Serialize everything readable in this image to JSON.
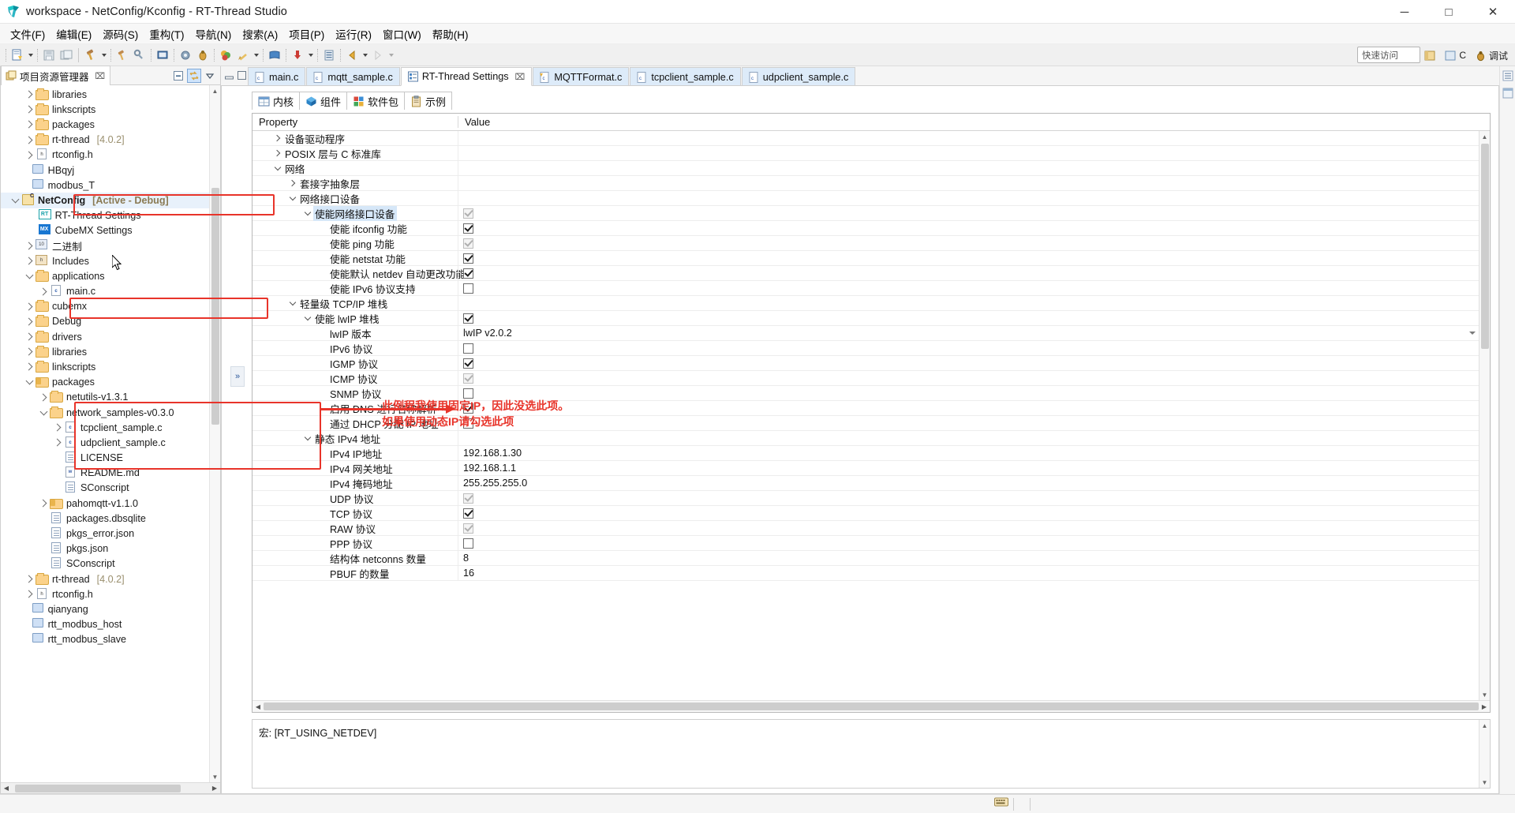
{
  "window": {
    "title": "workspace - NetConfig/Kconfig - RT-Thread Studio",
    "app_icon": "rtthread-logo-icon",
    "buttons": {
      "minimize": "─",
      "maximize": "□",
      "close": "✕"
    }
  },
  "menubar": {
    "items": [
      {
        "label": "文件(F)"
      },
      {
        "label": "编辑(E)"
      },
      {
        "label": "源码(S)"
      },
      {
        "label": "重构(T)"
      },
      {
        "label": "导航(N)"
      },
      {
        "label": "搜索(A)"
      },
      {
        "label": "项目(P)"
      },
      {
        "label": "运行(R)"
      },
      {
        "label": "窗口(W)"
      },
      {
        "label": "帮助(H)"
      }
    ]
  },
  "toolbar": {
    "quick_access_placeholder": "快速访问",
    "perspective_c": "C",
    "perspective_debug": "调试",
    "icons": [
      "new-file-icon",
      "save-icon",
      "save-all-icon",
      "build-hammer-icon",
      "clean-hammer-icon",
      "wrench-icon",
      "terminal-icon",
      "settings-gear-icon",
      "debug-bug-icon",
      "package-icon",
      "pencil-icon",
      "book-icon",
      "download-icon",
      "list-icon",
      "back-arrow-icon",
      "forward-arrow-icon"
    ]
  },
  "project_explorer": {
    "tab_title": "项目资源管理器",
    "tab_close": "⌧",
    "tools": [
      "collapse-all-icon",
      "link-with-editor-icon",
      "view-menu-icon"
    ],
    "items": [
      {
        "indent": 1,
        "twisty": "right",
        "icon": "folder",
        "label": "libraries"
      },
      {
        "indent": 1,
        "twisty": "right",
        "icon": "folder",
        "label": "linkscripts"
      },
      {
        "indent": 1,
        "twisty": "right",
        "icon": "folder",
        "label": "packages"
      },
      {
        "indent": 1,
        "twisty": "right",
        "icon": "folder",
        "label": "rt-thread",
        "suffix": "[4.0.2]"
      },
      {
        "indent": 1,
        "twisty": "right",
        "icon": "header",
        "label": "rtconfig.h"
      },
      {
        "indent": 0.7,
        "twisty": "none",
        "icon": "box",
        "label": "HBqyj"
      },
      {
        "indent": 0.7,
        "twisty": "none",
        "icon": "box",
        "label": "modbus_T"
      },
      {
        "indent": 0,
        "twisty": "down",
        "icon": "project",
        "label": "NetConfig",
        "bold": true,
        "suffix": "[Active - Debug]",
        "selected": true
      },
      {
        "indent": 1.2,
        "twisty": "none",
        "icon": "rt",
        "label": "RT-Thread Settings"
      },
      {
        "indent": 1.2,
        "twisty": "none",
        "icon": "mx",
        "label": "CubeMX Settings"
      },
      {
        "indent": 1,
        "twisty": "right",
        "icon": "bin",
        "label": "二进制"
      },
      {
        "indent": 1,
        "twisty": "right",
        "icon": "includes",
        "label": "Includes"
      },
      {
        "indent": 1,
        "twisty": "down",
        "icon": "folder",
        "label": "applications"
      },
      {
        "indent": 2,
        "twisty": "right",
        "icon": "cfile",
        "label": "main.c"
      },
      {
        "indent": 1,
        "twisty": "right",
        "icon": "folder",
        "label": "cubemx"
      },
      {
        "indent": 1,
        "twisty": "right",
        "icon": "folder",
        "label": "Debug"
      },
      {
        "indent": 1,
        "twisty": "right",
        "icon": "folder",
        "label": "drivers"
      },
      {
        "indent": 1,
        "twisty": "right",
        "icon": "folder",
        "label": "libraries"
      },
      {
        "indent": 1,
        "twisty": "right",
        "icon": "folder",
        "label": "linkscripts"
      },
      {
        "indent": 1,
        "twisty": "down",
        "icon": "pkgfolder",
        "label": "packages"
      },
      {
        "indent": 2,
        "twisty": "right",
        "icon": "folder",
        "label": "netutils-v1.3.1"
      },
      {
        "indent": 2,
        "twisty": "down",
        "icon": "folder",
        "label": "network_samples-v0.3.0"
      },
      {
        "indent": 3,
        "twisty": "right",
        "icon": "cfile",
        "label": "tcpclient_sample.c"
      },
      {
        "indent": 3,
        "twisty": "right",
        "icon": "cfile",
        "label": "udpclient_sample.c"
      },
      {
        "indent": 3,
        "twisty": "none",
        "icon": "file",
        "label": "LICENSE"
      },
      {
        "indent": 3,
        "twisty": "none",
        "icon": "md",
        "label": "README.md"
      },
      {
        "indent": 3,
        "twisty": "none",
        "icon": "file",
        "label": "SConscript"
      },
      {
        "indent": 2,
        "twisty": "right",
        "icon": "pkgfolder",
        "label": "pahomqtt-v1.1.0"
      },
      {
        "indent": 2,
        "twisty": "none",
        "icon": "file",
        "label": "packages.dbsqlite"
      },
      {
        "indent": 2,
        "twisty": "none",
        "icon": "file",
        "label": "pkgs_error.json"
      },
      {
        "indent": 2,
        "twisty": "none",
        "icon": "file",
        "label": "pkgs.json"
      },
      {
        "indent": 2,
        "twisty": "none",
        "icon": "file",
        "label": "SConscript"
      },
      {
        "indent": 1,
        "twisty": "right",
        "icon": "folder",
        "label": "rt-thread",
        "suffix": "[4.0.2]"
      },
      {
        "indent": 1,
        "twisty": "right",
        "icon": "header",
        "label": "rtconfig.h"
      },
      {
        "indent": 0.7,
        "twisty": "none",
        "icon": "box",
        "label": "qianyang"
      },
      {
        "indent": 0.7,
        "twisty": "none",
        "icon": "box",
        "label": "rtt_modbus_host"
      },
      {
        "indent": 0.7,
        "twisty": "none",
        "icon": "box",
        "label": "rtt_modbus_slave"
      }
    ]
  },
  "editor_tabs": [
    {
      "label": "main.c",
      "icon": "c-file-icon",
      "active": false
    },
    {
      "label": "mqtt_sample.c",
      "icon": "c-file-icon",
      "active": false
    },
    {
      "label": "RT-Thread Settings",
      "icon": "settings-icon",
      "active": true,
      "close": "⌧"
    },
    {
      "label": "MQTTFormat.c",
      "icon": "c-warning-icon",
      "active": false
    },
    {
      "label": "tcpclient_sample.c",
      "icon": "c-file-icon",
      "active": false
    },
    {
      "label": "udpclient_sample.c",
      "icon": "c-file-icon",
      "active": false
    }
  ],
  "settings_tabs": [
    {
      "label": "内核",
      "icon": "kernel-grid-icon",
      "active": false
    },
    {
      "label": "组件",
      "icon": "components-cube-icon",
      "active": true
    },
    {
      "label": "软件包",
      "icon": "packages-icon",
      "active": false
    },
    {
      "label": "示例",
      "icon": "examples-clipboard-icon",
      "active": false
    }
  ],
  "table": {
    "header": {
      "property": "Property",
      "value": "Value"
    },
    "rows": [
      {
        "indent": 1,
        "twisty": "right",
        "label": "设备驱动程序",
        "value_type": "none"
      },
      {
        "indent": 1,
        "twisty": "right",
        "label": "POSIX 层与 C 标准库",
        "value_type": "none"
      },
      {
        "indent": 1,
        "twisty": "down",
        "label": "网络",
        "value_type": "none"
      },
      {
        "indent": 2,
        "twisty": "right",
        "label": "套接字抽象层",
        "value_type": "none"
      },
      {
        "indent": 2,
        "twisty": "down",
        "label": "网络接口设备",
        "value_type": "none"
      },
      {
        "indent": 3,
        "twisty": "down",
        "label": "使能网络接口设备",
        "value_type": "checkbox",
        "checked": true,
        "disabled": true,
        "selected": true
      },
      {
        "indent": 4,
        "twisty": "none",
        "label": "使能 ifconfig 功能",
        "value_type": "checkbox",
        "checked": true
      },
      {
        "indent": 4,
        "twisty": "none",
        "label": "使能 ping 功能",
        "value_type": "checkbox",
        "checked": true,
        "disabled": true
      },
      {
        "indent": 4,
        "twisty": "none",
        "label": "使能 netstat 功能",
        "value_type": "checkbox",
        "checked": true
      },
      {
        "indent": 4,
        "twisty": "none",
        "label": "使能默认 netdev 自动更改功能",
        "value_type": "checkbox",
        "checked": true
      },
      {
        "indent": 4,
        "twisty": "none",
        "label": "使能 IPv6 协议支持",
        "value_type": "checkbox",
        "checked": false
      },
      {
        "indent": 2,
        "twisty": "down",
        "label": "轻量级 TCP/IP 堆栈",
        "value_type": "none"
      },
      {
        "indent": 3,
        "twisty": "down",
        "label": "使能 lwIP 堆栈",
        "value_type": "checkbox",
        "checked": true
      },
      {
        "indent": 4,
        "twisty": "none",
        "label": "lwIP 版本",
        "value_type": "combo",
        "value": "lwIP v2.0.2"
      },
      {
        "indent": 4,
        "twisty": "none",
        "label": "IPv6 协议",
        "value_type": "checkbox",
        "checked": false
      },
      {
        "indent": 4,
        "twisty": "none",
        "label": "IGMP 协议",
        "value_type": "checkbox",
        "checked": true
      },
      {
        "indent": 4,
        "twisty": "none",
        "label": "ICMP 协议",
        "value_type": "checkbox",
        "checked": true,
        "disabled": true
      },
      {
        "indent": 4,
        "twisty": "none",
        "label": "SNMP 协议",
        "value_type": "checkbox",
        "checked": false
      },
      {
        "indent": 4,
        "twisty": "none",
        "label": "启用 DNS 进行名称解析",
        "value_type": "checkbox",
        "checked": true
      },
      {
        "indent": 4,
        "twisty": "none",
        "label": "通过 DHCP 分配 IP 地址",
        "value_type": "checkbox",
        "checked": false
      },
      {
        "indent": 3,
        "twisty": "down",
        "label": "静态 IPv4 地址",
        "value_type": "none"
      },
      {
        "indent": 4,
        "twisty": "none",
        "label": "IPv4 IP地址",
        "value_type": "text",
        "value": "192.168.1.30"
      },
      {
        "indent": 4,
        "twisty": "none",
        "label": "IPv4 网关地址",
        "value_type": "text",
        "value": "192.168.1.1"
      },
      {
        "indent": 4,
        "twisty": "none",
        "label": "IPv4 掩码地址",
        "value_type": "text",
        "value": "255.255.255.0"
      },
      {
        "indent": 4,
        "twisty": "none",
        "label": "UDP 协议",
        "value_type": "checkbox",
        "checked": true,
        "disabled": true
      },
      {
        "indent": 4,
        "twisty": "none",
        "label": "TCP 协议",
        "value_type": "checkbox",
        "checked": true
      },
      {
        "indent": 4,
        "twisty": "none",
        "label": "RAW 协议",
        "value_type": "checkbox",
        "checked": true,
        "disabled": true
      },
      {
        "indent": 4,
        "twisty": "none",
        "label": "PPP 协议",
        "value_type": "checkbox",
        "checked": false
      },
      {
        "indent": 4,
        "twisty": "none",
        "label": "结构体 netconns 数量",
        "value_type": "text",
        "value": "8"
      },
      {
        "indent": 4,
        "twisty": "none",
        "label": "PBUF 的数量",
        "value_type": "text",
        "value": "16"
      }
    ]
  },
  "macro_pane": {
    "text": "宏: [RT_USING_NETDEV]"
  },
  "annotations": {
    "note": "此例程我使用固定IP，因此没选此项。\n如果使用动态IP请勾选此项",
    "note_color": "#e8342a"
  },
  "statusbar": {
    "writable_icon": "keyboard-icon"
  }
}
